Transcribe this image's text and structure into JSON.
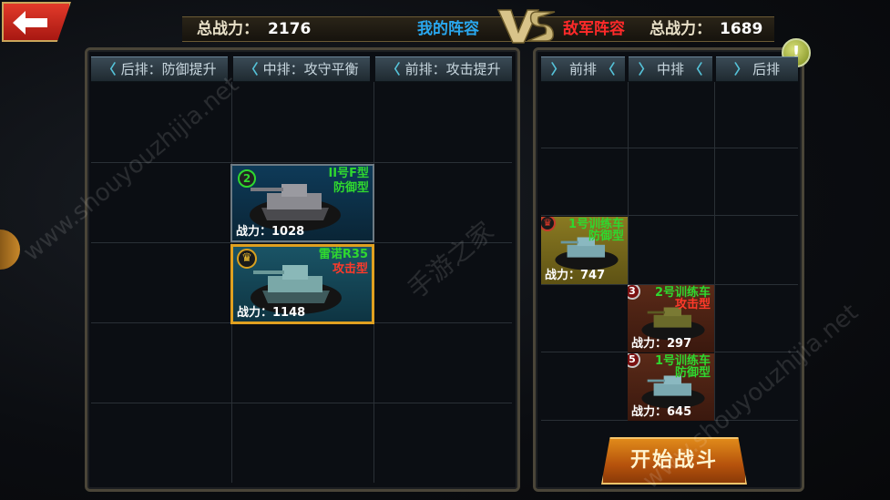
{
  "header": {
    "my_power_label": "总战力：",
    "my_power_value": "2176",
    "my_lineup": "我的阵容",
    "enemy_lineup": "敌军阵容",
    "enemy_power_label": "总战力：",
    "enemy_power_value": "1689",
    "vs": "VS"
  },
  "left_rows": [
    {
      "label": "后排：防御提升"
    },
    {
      "label": "中排：攻守平衡"
    },
    {
      "label": "前排：攻击提升"
    }
  ],
  "right_rows": [
    {
      "label": "前排"
    },
    {
      "label": "中排"
    },
    {
      "label": "后排"
    }
  ],
  "my_units": [
    {
      "badge": "2",
      "name": "II号F型",
      "type": "防御型",
      "power_label": "战力：",
      "power": "1028"
    },
    {
      "badge": "crown",
      "name": "雷诺R35",
      "type": "攻击型",
      "power_label": "战力：",
      "power": "1148"
    }
  ],
  "enemy_units": [
    {
      "badge": "crown",
      "name": "1号训练车",
      "type": "防御型",
      "power_label": "战力：",
      "power": "747"
    },
    {
      "badge": "3",
      "name": "2号训练车",
      "type": "攻击型",
      "power_label": "战力：",
      "power": "297"
    },
    {
      "badge": "5",
      "name": "1号训练车",
      "type": "防御型",
      "power_label": "战力：",
      "power": "645"
    }
  ],
  "start_button": "开始战斗",
  "info_button": "!",
  "watermarks": [
    "www.shouyouzhijia.net",
    "手游之家",
    "www.shouyouzhijia.net"
  ],
  "colors": {
    "green": "#2fd82f",
    "attack_red": "#ff3a2a",
    "defense_green": "#2fd82f",
    "blue_title": "#29a8f0",
    "red_title": "#ff2a2a"
  }
}
